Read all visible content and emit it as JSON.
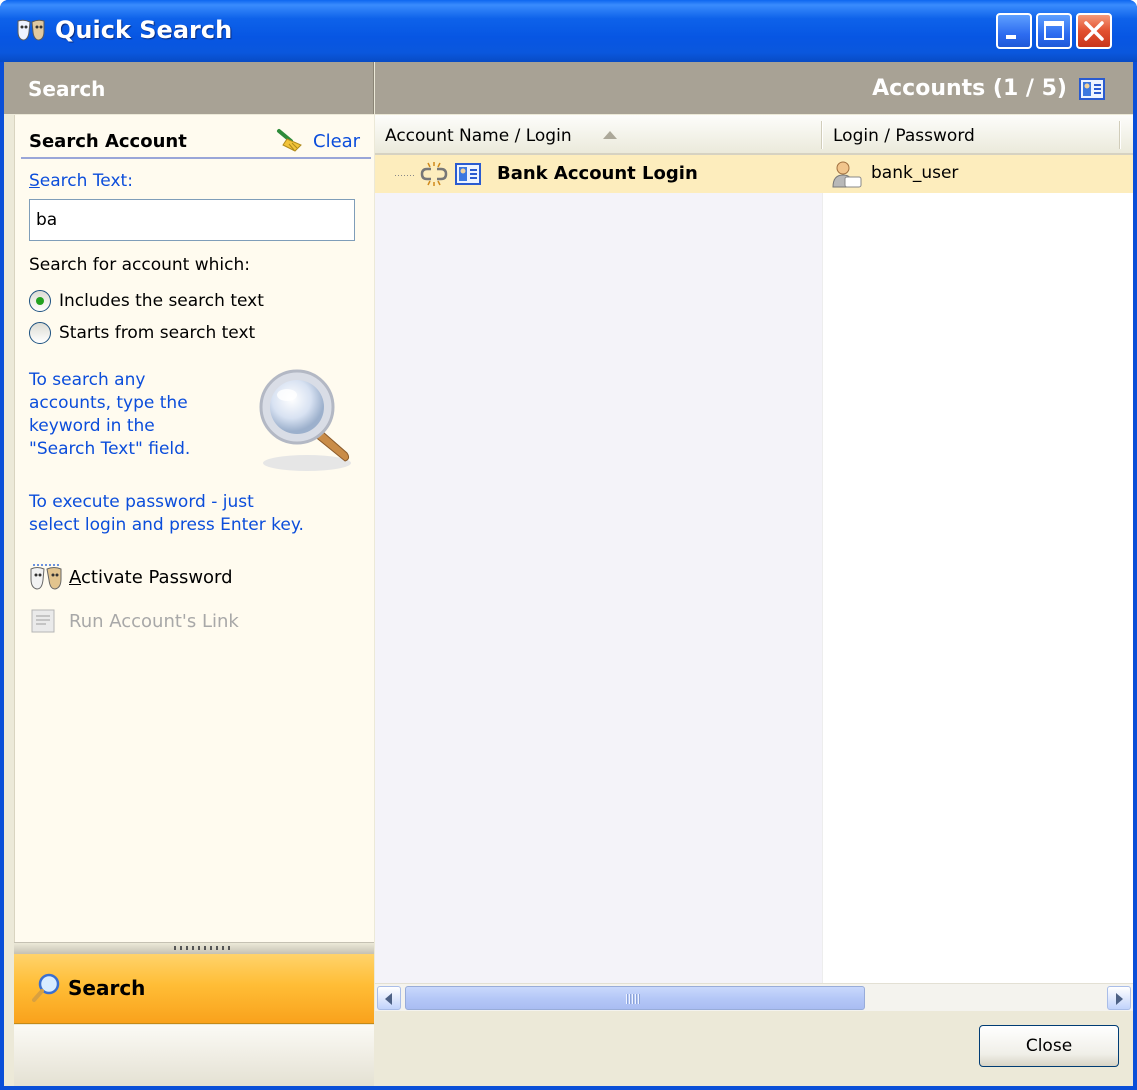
{
  "window": {
    "title": "Quick Search",
    "icons": {
      "app": "masks-icon",
      "minimize": "minimize-icon",
      "maximize": "maximize-icon",
      "close": "close-icon"
    }
  },
  "left": {
    "header": "Search",
    "section_title": "Search Account",
    "clear_label": "Clear",
    "search_text_label": "Search Text:",
    "search_text_value": "ba",
    "search_for_label": "Search for account which:",
    "options": [
      {
        "label": "Includes the search text",
        "selected": true
      },
      {
        "label": "Starts from search text",
        "selected": false
      }
    ],
    "hint1": "To search any\naccounts, type the\nkeyword in the\n\"Search Text\" field.",
    "hint2": "To execute password - just\nselect login and press Enter key.",
    "activate_label": "Activate Password",
    "run_link_label": "Run Account's Link",
    "nav_search_label": "Search"
  },
  "right": {
    "header_title": "Accounts (1 / 5)",
    "columns": [
      "Account Name / Login",
      "Login / Password"
    ],
    "rows": [
      {
        "name": "Bank Account Login",
        "login": "bank_user"
      }
    ],
    "close_label": "Close"
  },
  "colors": {
    "titlebar": "#0a57dd",
    "header_bg": "#a8a295",
    "hint_text": "#0b4ddb",
    "selected_row": "#fdedbd",
    "nav_active": "#ffbd36"
  }
}
